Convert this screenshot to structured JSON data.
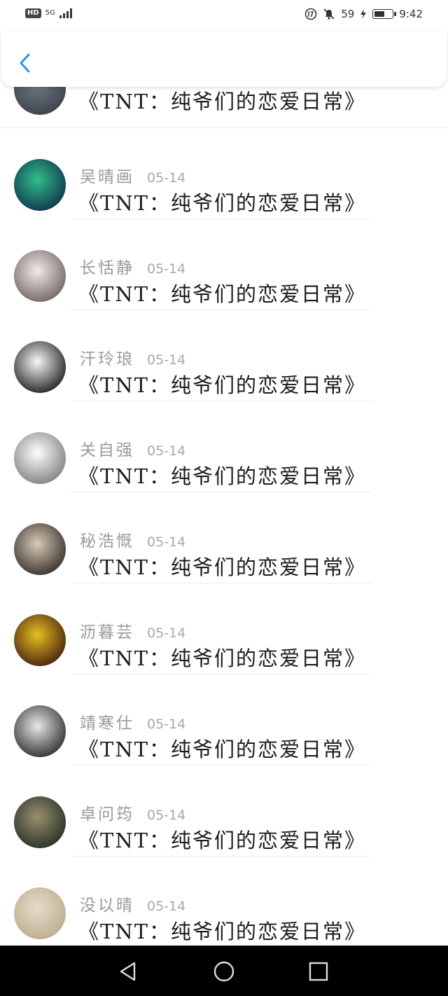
{
  "status_bar": {
    "hd": "HD",
    "network": "5G",
    "battery_text": "59",
    "time": "9:42",
    "battery_level": 0.59
  },
  "header": {
    "back_icon": "chevron-left-icon",
    "accent_color": "#2196F3"
  },
  "list": {
    "items": [
      {
        "name": "",
        "date": "",
        "title": "《TNT：纯爷们的恋爱日常》",
        "avatar_colors": [
          "#6d7b86",
          "#3a3f45"
        ]
      },
      {
        "name": "吴晴画",
        "date": "05-14",
        "title": "《TNT：纯爷们的恋爱日常》",
        "avatar_colors": [
          "#2fbf88",
          "#0e2a4a"
        ]
      },
      {
        "name": "长恬静",
        "date": "05-14",
        "title": "《TNT：纯爷们的恋爱日常》",
        "avatar_colors": [
          "#f0ece8",
          "#6a5a58"
        ]
      },
      {
        "name": "汗玲琅",
        "date": "05-14",
        "title": "《TNT：纯爷们的恋爱日常》",
        "avatar_colors": [
          "#f8f8f8",
          "#111111"
        ]
      },
      {
        "name": "关自强",
        "date": "05-14",
        "title": "《TNT：纯爷们的恋爱日常》",
        "avatar_colors": [
          "#ffffff",
          "#777777"
        ]
      },
      {
        "name": "秘浩慨",
        "date": "05-14",
        "title": "《TNT：纯爷们的恋爱日常》",
        "avatar_colors": [
          "#d9cab8",
          "#2a2522"
        ]
      },
      {
        "name": "沥暮芸",
        "date": "05-14",
        "title": "《TNT：纯爷们的恋爱日常》",
        "avatar_colors": [
          "#e8c020",
          "#3a1410"
        ]
      },
      {
        "name": "靖寒仕",
        "date": "05-14",
        "title": "《TNT：纯爷们的恋爱日常》",
        "avatar_colors": [
          "#e8e8e8",
          "#222222"
        ]
      },
      {
        "name": "卓问筠",
        "date": "05-14",
        "title": "《TNT：纯爷们的恋爱日常》",
        "avatar_colors": [
          "#9a8f70",
          "#1f2a20"
        ]
      },
      {
        "name": "没以晴",
        "date": "05-14",
        "title": "《TNT：纯爷们的恋爱日常》",
        "avatar_colors": [
          "#e6ddc9",
          "#b8a98a"
        ]
      }
    ]
  },
  "nav_bar": {
    "back": "back-triangle-icon",
    "home": "home-circle-icon",
    "recents": "recents-square-icon"
  }
}
